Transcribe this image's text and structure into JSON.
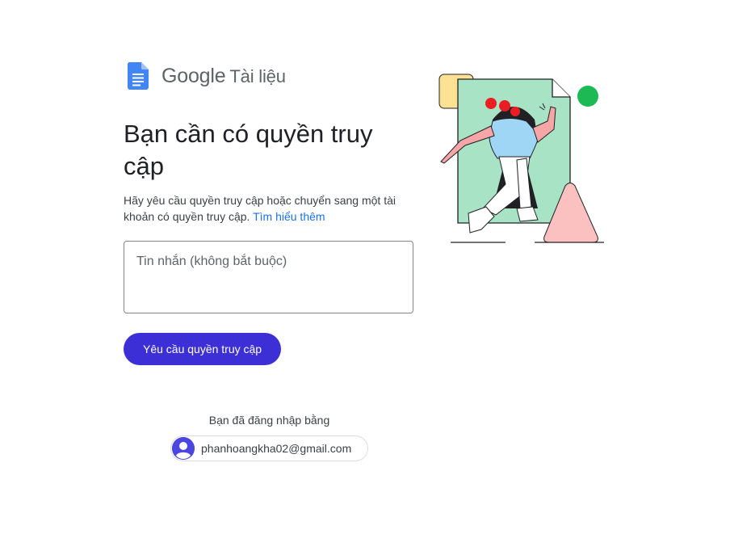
{
  "brand": {
    "google": "Google",
    "product": "Tài liệu"
  },
  "main": {
    "title": "Bạn cần có quyền truy cập",
    "description": "Hãy yêu cầu quyền truy cập hoặc chuyển sang một tài khoản có quyền truy cập.",
    "learn_more": "Tìm hiểu thêm",
    "message_placeholder": "Tin nhắn (không bắt buộc)",
    "request_button": "Yêu cầu quyền truy cập"
  },
  "account": {
    "signed_in_label": "Bạn đã đăng nhập bằng",
    "email": "phanhoangkha02@gmail.com"
  },
  "colors": {
    "accent": "#3d2fd6",
    "link": "#1a73e8",
    "docs_blue": "#4285f4"
  },
  "icons": [
    "docs-icon",
    "account-avatar-icon",
    "illustration"
  ]
}
